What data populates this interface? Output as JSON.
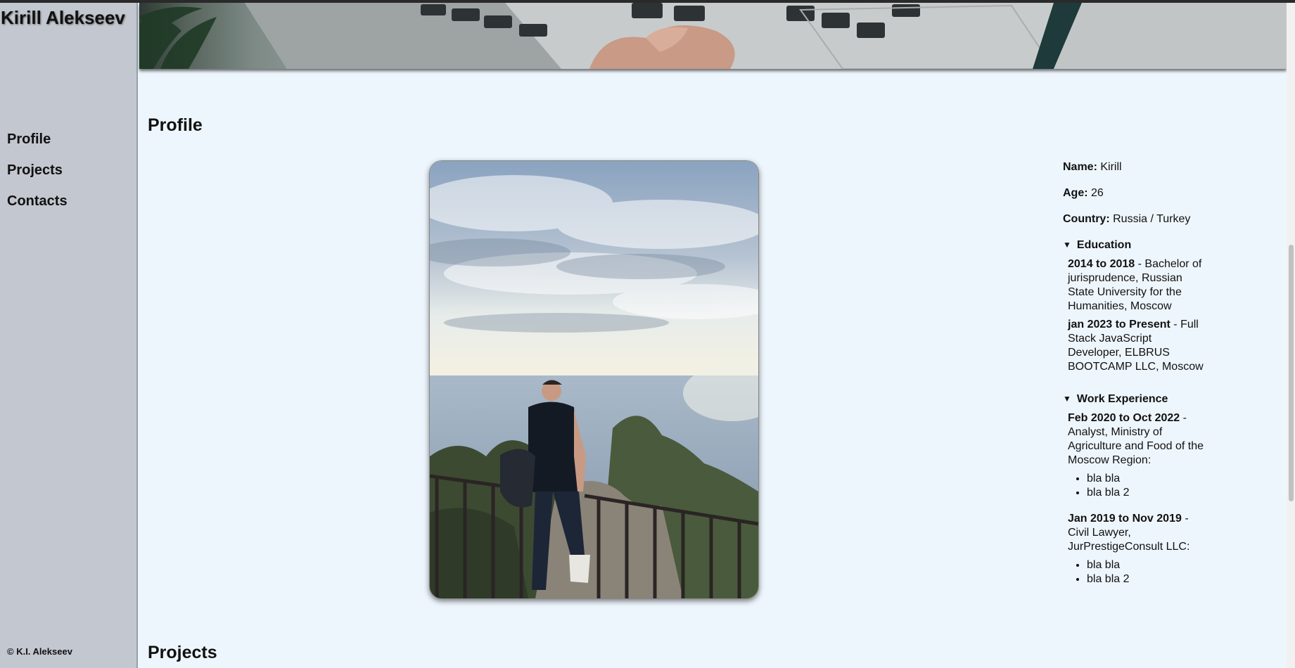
{
  "sidebar": {
    "title": "Kirill Alekseev",
    "nav": [
      {
        "label": "Profile"
      },
      {
        "label": "Projects"
      },
      {
        "label": "Contacts"
      }
    ],
    "copyright": "© K.I. Alekseev"
  },
  "profile": {
    "heading": "Profile",
    "fields": [
      {
        "label": "Name:",
        "value": "Kirill"
      },
      {
        "label": "Age:",
        "value": "26"
      },
      {
        "label": "Country:",
        "value": "Russia / Turkey"
      }
    ],
    "education": {
      "summary": "Education",
      "entries": [
        {
          "period": "2014 to 2018",
          "text": " - Bachelor of jurisprudence, Russian State University for the Humanities, Moscow"
        },
        {
          "period": "jan 2023 to Present",
          "text": " - Full Stack JavaScript Developer, ELBRUS BOOTCAMP LLC, Moscow"
        }
      ]
    },
    "work": {
      "summary": "Work Experience",
      "entries": [
        {
          "period": "Feb 2020 to Oct 2022",
          "text": " - Analyst, Ministry of Agriculture and Food of the Moscow Region:",
          "items": [
            "bla bla",
            "bla bla 2"
          ]
        },
        {
          "period": "Jan 2019 to Nov 2019",
          "text": " - Civil Lawyer, JurPrestigeConsult LLC:",
          "items": [
            "bla bla",
            "bla bla 2"
          ]
        }
      ]
    }
  },
  "projects": {
    "heading": "Projects"
  }
}
